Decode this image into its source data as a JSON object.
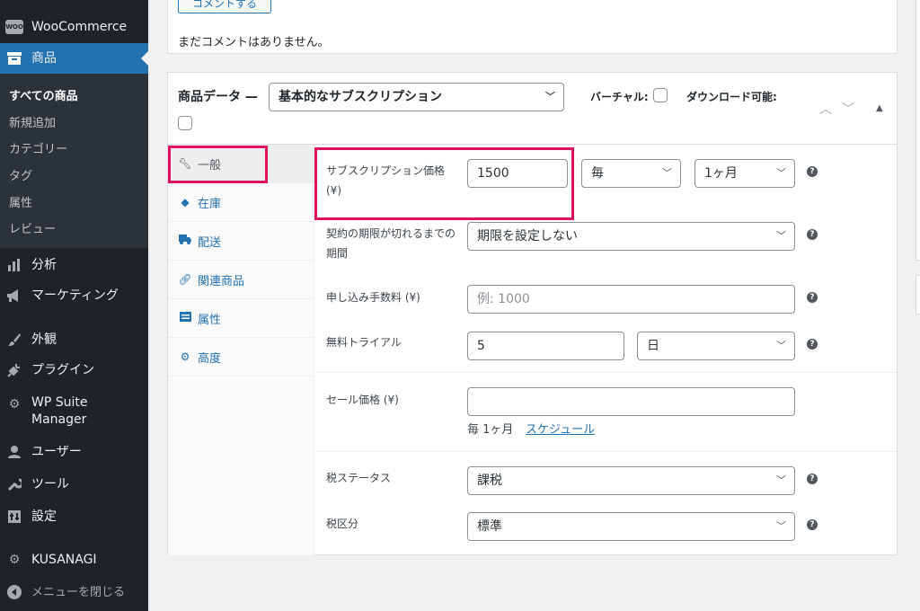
{
  "sidebar": {
    "woocommerce": {
      "label": "WooCommerce",
      "icon": "woocommerce-icon",
      "badge": "WOO"
    },
    "products": {
      "label": "商品",
      "icon": "archive-icon"
    },
    "submenu": [
      {
        "label": "すべての商品",
        "current": true
      },
      {
        "label": "新規追加"
      },
      {
        "label": "カテゴリー"
      },
      {
        "label": "タグ"
      },
      {
        "label": "属性"
      },
      {
        "label": "レビュー"
      }
    ],
    "items": [
      {
        "label": "分析",
        "icon": "chart-bar-icon"
      },
      {
        "label": "マーケティング",
        "icon": "megaphone-icon"
      },
      {
        "label": "外観",
        "icon": "paintbrush-icon"
      },
      {
        "label": "プラグイン",
        "icon": "plugin-icon"
      },
      {
        "label": "WP Suite\nManager",
        "icon": "gear-icon"
      },
      {
        "label": "ユーザー",
        "icon": "user-icon"
      },
      {
        "label": "ツール",
        "icon": "wrench-icon"
      },
      {
        "label": "設定",
        "icon": "settings-icon"
      },
      {
        "label": "KUSANAGI",
        "icon": "gear-icon"
      },
      {
        "label": "メニューを閉じる",
        "icon": "collapse-icon"
      }
    ]
  },
  "comments": {
    "button_label": "コメントする",
    "empty_text": "まだコメントはありません。"
  },
  "product_data": {
    "title": "商品データ —",
    "type_select": "基本的なサブスクリプション",
    "virtual_label": "バーチャル:",
    "downloadable_label": "ダウンロード可能:",
    "tabs": [
      {
        "label": "一般",
        "icon": "wrench-icon",
        "active": true
      },
      {
        "label": "在庫",
        "icon": "tag-icon"
      },
      {
        "label": "配送",
        "icon": "truck-icon"
      },
      {
        "label": "関連商品",
        "icon": "link-icon"
      },
      {
        "label": "属性",
        "icon": "list-icon"
      },
      {
        "label": "高度",
        "icon": "gear-icon"
      }
    ],
    "fields": {
      "sub_price_label": "サブスクリプション価格\n(¥)",
      "sub_price_value": "1500",
      "interval": "毎",
      "period": "1ヶ月",
      "expire_label": "契約の期限が切れるまでの\n期間",
      "expire_value": "期限を設定しない",
      "signup_fee_label": "申し込み手数料 (¥)",
      "signup_fee_placeholder": "例: 1000",
      "trial_label": "無料トライアル",
      "trial_value": "5",
      "trial_period": "日",
      "sale_label": "セール価格 (¥)",
      "sale_value": "",
      "sale_note": "毎 1ヶ月",
      "schedule_link": "スケジュール",
      "tax_status_label": "税ステータス",
      "tax_status_value": "課税",
      "tax_class_label": "税区分",
      "tax_class_value": "標準"
    }
  }
}
